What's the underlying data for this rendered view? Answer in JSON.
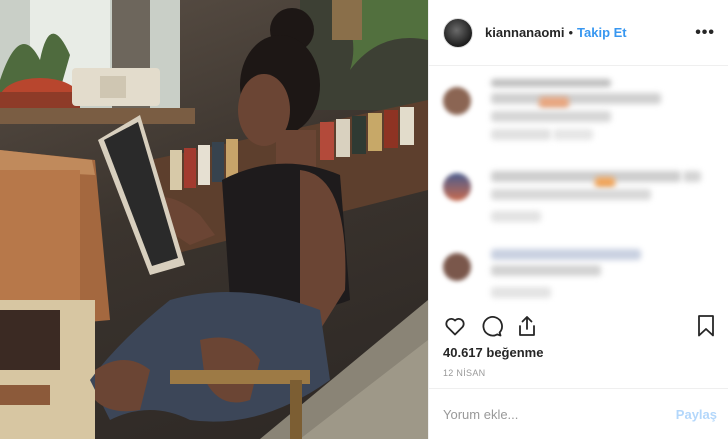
{
  "header": {
    "username": "kiannanaomi",
    "separator": "•",
    "follow_label": "Takip Et",
    "more_label": "•••"
  },
  "actions": {
    "like_icon": "heart-icon",
    "comment_icon": "comment-icon",
    "share_icon": "share-icon",
    "save_icon": "bookmark-icon"
  },
  "post": {
    "likes_text": "40.617 beğenme",
    "date_text": "12 NİSAN"
  },
  "comment_box": {
    "placeholder": "Yorum ekle...",
    "post_label": "Paylaş"
  },
  "colors": {
    "accent": "#3897f0",
    "post_disabled": "#b3d7fb",
    "text": "#262626",
    "muted": "#999999"
  }
}
